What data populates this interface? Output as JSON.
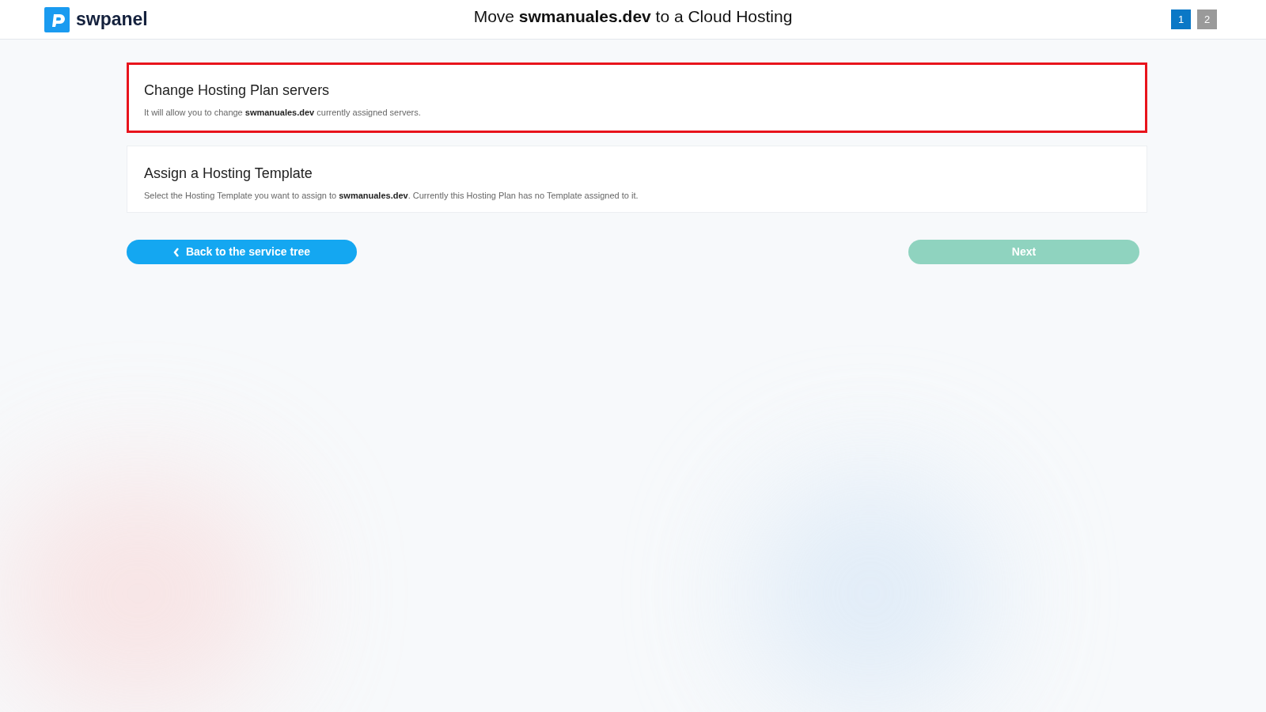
{
  "header": {
    "logo_text": "swpanel",
    "title": "Move **swmanuales.dev** to a Cloud Hosting",
    "steps": [
      {
        "label": "1",
        "selected": true
      },
      {
        "label": "2",
        "selected": false
      }
    ]
  },
  "options": [
    {
      "title": "Change Hosting Plan servers",
      "description": "It will allow you to change **swmanuales.dev** currently assigned servers.",
      "highlighted": true
    },
    {
      "title": "Assign a Hosting Template",
      "description": "Select the Hosting Template you want to assign to **swmanuales.dev**. Currently this Hosting Plan has no Template assigned to it.",
      "highlighted": false
    }
  ],
  "back_button": {
    "label": "Back to the service tree"
  },
  "next_button": {
    "label": "Next",
    "disabled": true
  }
}
